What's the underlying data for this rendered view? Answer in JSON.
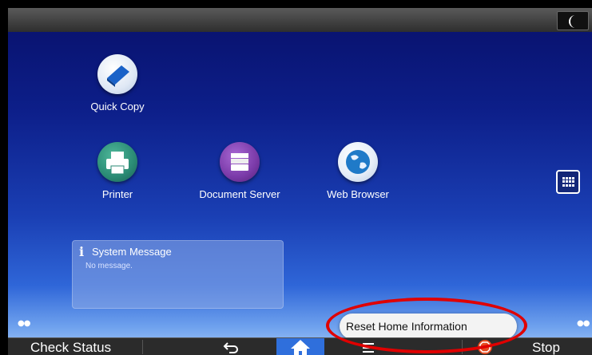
{
  "topbar": {
    "sleep_icon": "moon-icon"
  },
  "apps": [
    {
      "label": "Quick Copy",
      "icon": "copy-icon",
      "color": "#1a62c8"
    },
    {
      "label": "Printer",
      "icon": "printer-icon",
      "color": "#2a8a74"
    },
    {
      "label": "Document Server",
      "icon": "document-server-icon",
      "color": "#7a3aa8"
    },
    {
      "label": "Web Browser",
      "icon": "globe-icon",
      "color": "#1f7ac8"
    }
  ],
  "app_list_button": {
    "icon": "grid-icon"
  },
  "system_message": {
    "title": "System Message",
    "body": "No message."
  },
  "popup": {
    "label": "Reset Home Information"
  },
  "bottombar": {
    "check_status": "Check Status",
    "back_icon": "back-arrow-icon",
    "home_icon": "home-icon",
    "menu_icon": "menu-icon",
    "stop_icon": "stop-icon",
    "stop": "Stop",
    "home_color": "#2f6fdc"
  },
  "annotation": {
    "color": "#e00000"
  }
}
